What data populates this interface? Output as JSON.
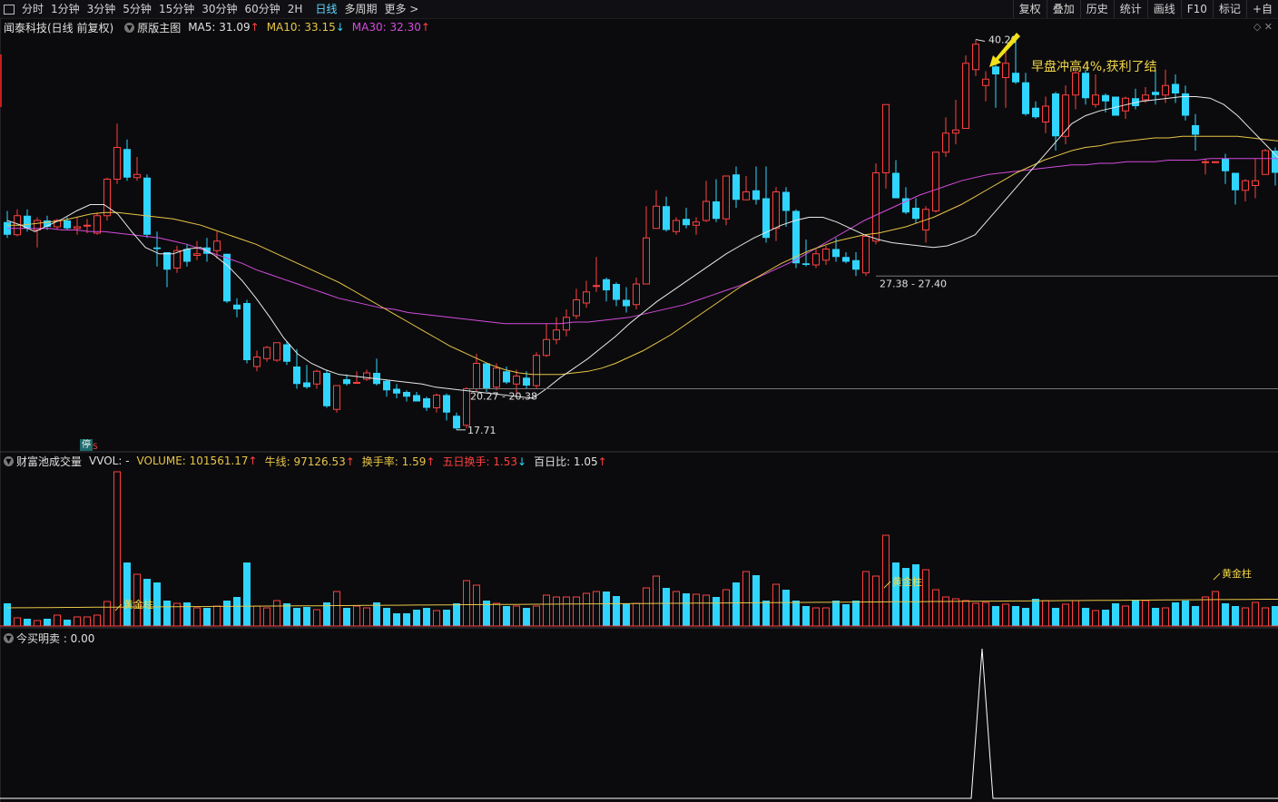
{
  "toolbar": {
    "periods": [
      "分时",
      "1分钟",
      "3分钟",
      "5分钟",
      "15分钟",
      "30分钟",
      "60分钟",
      "2H",
      "日线",
      "多周期",
      "更多 >"
    ],
    "active": "日线",
    "right": [
      "复权",
      "叠加",
      "历史",
      "统计",
      "画线",
      "F10",
      "标记",
      "+自"
    ]
  },
  "main": {
    "stock": "闻泰科技(日线 前复权)",
    "indicator": "原版主图",
    "ma5": "MA5: 31.09",
    "ma5_dir": "↑",
    "ma10": "MA10: 33.15",
    "ma10_dir": "↓",
    "ma30": "MA30: 32.30",
    "ma30_dir": "↑",
    "annotation": "早盘冲高4%,获利了结",
    "label_high": "40.20",
    "label_low": "17.71",
    "label_range1": "20.27 - 20.38",
    "label_range2": "27.38 - 27.40",
    "stop_badge": "停",
    "stop_s": "S"
  },
  "volume": {
    "title": "财富池成交量",
    "vvol": "VVOL: -",
    "volume": "VOLUME: 101561.17",
    "volume_dir": "↑",
    "bull": "牛线: 97126.53",
    "bull_dir": "↑",
    "turnover": "换手率: 1.59",
    "turnover_dir": "↑",
    "five_day": "五日换手: 1.53",
    "five_day_dir": "↓",
    "hundred": "百日比: 1.05",
    "hundred_dir": "↑",
    "golden": "黄金柱"
  },
  "bottom": {
    "title": "今买明卖 : 0.00"
  },
  "colors": {
    "up": "#ff4040",
    "down": "#30d5ff",
    "ma5": "#e8e8e8",
    "ma10": "#e8c547",
    "ma30": "#d44bdc",
    "background": "#0b0b0d"
  },
  "chart_data": {
    "type": "candlestick",
    "price_range": [
      16.5,
      42.5
    ],
    "candles": [
      [
        30.8,
        30.0,
        31.5,
        29.8
      ],
      [
        30.0,
        31.2,
        31.6,
        29.9
      ],
      [
        31.2,
        30.4,
        31.6,
        30.2
      ],
      [
        30.3,
        30.9,
        31.1,
        29.2
      ],
      [
        30.9,
        30.5,
        31.2,
        30.3
      ],
      [
        30.5,
        30.9,
        31.0,
        30.3
      ],
      [
        30.9,
        30.4,
        31.1,
        30.3
      ],
      [
        30.4,
        30.5,
        31.1,
        30.0
      ],
      [
        30.6,
        30.6,
        31.0,
        30.1
      ],
      [
        30.1,
        31.2,
        31.4,
        30.0
      ],
      [
        31.2,
        33.5,
        33.6,
        30.9
      ],
      [
        33.5,
        35.5,
        37.0,
        33.2
      ],
      [
        35.4,
        33.6,
        36.0,
        33.4
      ],
      [
        33.6,
        33.8,
        34.9,
        33.4
      ],
      [
        33.6,
        30.0,
        33.8,
        29.8
      ],
      [
        29.2,
        29.1,
        30.2,
        28.0
      ],
      [
        28.9,
        27.8,
        28.9,
        26.7
      ],
      [
        27.9,
        29.0,
        29.3,
        27.6
      ],
      [
        29.1,
        28.3,
        29.4,
        28.0
      ],
      [
        28.7,
        28.8,
        29.6,
        28.4
      ],
      [
        29.2,
        28.8,
        29.8,
        28.3
      ],
      [
        29.0,
        29.6,
        30.2,
        28.5
      ],
      [
        28.8,
        25.8,
        28.8,
        25.7
      ],
      [
        25.6,
        25.3,
        26.0,
        24.8
      ],
      [
        25.7,
        22.1,
        25.9,
        21.9
      ],
      [
        21.7,
        22.3,
        22.7,
        21.4
      ],
      [
        22.2,
        22.9,
        23.0,
        22.0
      ],
      [
        22.1,
        23.2,
        23.2,
        22.0
      ],
      [
        23.1,
        22.0,
        23.3,
        21.8
      ],
      [
        21.7,
        20.6,
        22.8,
        20.3
      ],
      [
        20.7,
        20.4,
        21.8,
        20.3
      ],
      [
        20.6,
        21.4,
        21.5,
        20.3
      ],
      [
        21.3,
        19.2,
        21.5,
        19.1
      ],
      [
        19.0,
        20.5,
        20.5,
        18.8
      ],
      [
        20.9,
        20.6,
        21.2,
        20.5
      ],
      [
        20.7,
        20.7,
        21.4,
        20.6
      ],
      [
        20.9,
        21.3,
        21.5,
        20.8
      ],
      [
        21.3,
        20.6,
        22.2,
        20.5
      ],
      [
        20.8,
        20.2,
        20.9,
        19.8
      ],
      [
        20.3,
        20.0,
        20.6,
        19.7
      ],
      [
        20.1,
        19.8,
        20.2,
        19.5
      ],
      [
        19.9,
        19.5,
        20.1,
        19.5
      ],
      [
        19.7,
        19.1,
        19.8,
        18.9
      ],
      [
        19.1,
        19.9,
        20.0,
        18.8
      ],
      [
        19.9,
        18.8,
        20.0,
        18.3
      ],
      [
        18.6,
        17.8,
        18.8,
        17.7
      ],
      [
        18.0,
        20.3,
        20.4,
        17.8
      ],
      [
        20.3,
        21.9,
        22.5,
        20.1
      ],
      [
        21.9,
        20.3,
        21.9,
        20.1
      ],
      [
        20.4,
        21.6,
        21.9,
        20.2
      ],
      [
        21.4,
        20.7,
        21.7,
        20.6
      ],
      [
        20.6,
        21.1,
        21.5,
        20.0
      ],
      [
        21.0,
        20.5,
        21.4,
        20.3
      ],
      [
        20.5,
        22.4,
        22.6,
        20.3
      ],
      [
        22.4,
        23.4,
        24.4,
        22.3
      ],
      [
        23.4,
        24.0,
        24.8,
        23.1
      ],
      [
        24.0,
        24.8,
        25.3,
        23.6
      ],
      [
        24.9,
        25.9,
        26.6,
        24.7
      ],
      [
        25.7,
        26.4,
        27.1,
        25.4
      ],
      [
        26.8,
        26.8,
        28.6,
        26.4
      ],
      [
        27.2,
        26.5,
        27.3,
        25.8
      ],
      [
        26.9,
        25.9,
        27.0,
        25.5
      ],
      [
        25.9,
        25.5,
        26.7,
        25.1
      ],
      [
        25.6,
        26.9,
        27.3,
        25.3
      ],
      [
        26.9,
        29.8,
        31.8,
        26.9
      ],
      [
        30.4,
        31.8,
        32.8,
        30.4
      ],
      [
        31.8,
        30.3,
        32.4,
        30.2
      ],
      [
        30.2,
        30.9,
        31.1,
        30.0
      ],
      [
        31.0,
        30.6,
        31.7,
        30.4
      ],
      [
        30.6,
        30.8,
        31.1,
        30.0
      ],
      [
        30.9,
        32.1,
        33.4,
        30.8
      ],
      [
        32.1,
        31.0,
        33.5,
        30.8
      ],
      [
        31.0,
        33.7,
        33.7,
        30.6
      ],
      [
        33.8,
        32.2,
        34.3,
        31.7
      ],
      [
        32.2,
        32.7,
        33.7,
        32.2
      ],
      [
        32.8,
        32.2,
        34.3,
        31.9
      ],
      [
        32.3,
        29.8,
        34.3,
        29.5
      ],
      [
        30.4,
        32.7,
        33.0,
        29.6
      ],
      [
        32.7,
        31.5,
        33.0,
        30.5
      ],
      [
        31.5,
        28.2,
        31.6,
        27.9
      ],
      [
        28.2,
        28.1,
        29.7,
        28.0
      ],
      [
        28.1,
        28.8,
        29.1,
        27.9
      ],
      [
        28.4,
        29.1,
        29.3,
        28.1
      ],
      [
        29.1,
        28.6,
        29.8,
        28.3
      ],
      [
        28.6,
        28.3,
        28.9,
        28.2
      ],
      [
        28.4,
        27.8,
        28.9,
        27.4
      ],
      [
        27.6,
        29.9,
        29.9,
        27.4
      ],
      [
        29.6,
        33.9,
        34.5,
        29.4
      ],
      [
        33.9,
        38.2,
        38.2,
        32.9
      ],
      [
        33.9,
        32.3,
        34.7,
        32.3
      ],
      [
        32.3,
        31.4,
        33.0,
        31.3
      ],
      [
        31.7,
        31.0,
        32.3,
        30.7
      ],
      [
        30.3,
        31.6,
        31.8,
        29.5
      ],
      [
        31.5,
        35.2,
        35.2,
        31.4
      ],
      [
        35.2,
        36.4,
        37.4,
        34.9
      ],
      [
        36.4,
        36.6,
        38.5,
        35.7
      ],
      [
        36.7,
        40.8,
        41.3,
        36.7
      ],
      [
        40.4,
        42.0,
        42.3,
        40.0
      ],
      [
        39.4,
        39.8,
        40.3,
        38.4
      ],
      [
        40.6,
        40.1,
        41.1,
        38.0
      ],
      [
        39.9,
        40.8,
        41.8,
        38.0
      ],
      [
        40.2,
        39.6,
        42.6,
        39.5
      ],
      [
        39.6,
        37.6,
        40.2,
        37.5
      ],
      [
        38.0,
        37.4,
        38.4,
        37.3
      ],
      [
        37.1,
        38.1,
        38.7,
        36.4
      ],
      [
        38.9,
        36.2,
        39.0,
        35.3
      ],
      [
        36.2,
        38.8,
        39.4,
        35.7
      ],
      [
        38.8,
        40.2,
        40.5,
        37.9
      ],
      [
        40.2,
        38.6,
        40.4,
        38.2
      ],
      [
        38.2,
        38.8,
        40.1,
        38.0
      ],
      [
        38.8,
        38.4,
        38.9,
        37.7
      ],
      [
        38.7,
        37.5,
        38.7,
        37.5
      ],
      [
        37.8,
        38.6,
        38.7,
        37.3
      ],
      [
        38.6,
        38.1,
        39.2,
        37.9
      ],
      [
        38.5,
        38.8,
        39.3,
        38.3
      ],
      [
        39.0,
        38.8,
        40.4,
        38.2
      ],
      [
        38.8,
        39.4,
        40.4,
        38.3
      ],
      [
        39.5,
        38.9,
        40.1,
        38.3
      ],
      [
        38.9,
        37.5,
        39.4,
        37.2
      ],
      [
        36.9,
        36.3,
        37.6,
        35.3
      ],
      [
        34.6,
        34.6,
        34.8,
        33.8
      ],
      [
        34.6,
        34.6,
        34.6,
        34.6
      ],
      [
        34.8,
        34.0,
        35.1,
        33.2
      ],
      [
        33.9,
        32.8,
        33.9,
        31.9
      ],
      [
        32.8,
        33.4,
        33.5,
        32.1
      ],
      [
        33.1,
        33.4,
        34.8,
        32.3
      ],
      [
        33.8,
        35.3,
        35.4,
        33.8
      ],
      [
        35.3,
        33.9,
        35.5,
        33.1
      ],
      [
        33.3,
        34.5,
        34.8,
        33.1
      ],
      [
        34.3,
        33.6,
        34.6,
        33.4
      ],
      [
        33.6,
        33.9,
        34.1,
        33.1
      ],
      [
        33.8,
        34.2,
        34.7,
        33.6
      ],
      [
        34.2,
        33.3,
        34.3,
        33.1
      ],
      [
        33.6,
        33.0,
        33.6,
        32.7
      ],
      [
        33.2,
        32.6,
        33.8,
        32.3
      ],
      [
        32.6,
        33.4,
        33.6,
        32.3
      ],
      [
        33.4,
        33.7,
        33.9,
        33.0
      ],
      [
        33.5,
        35.9,
        35.9,
        33.4
      ],
      [
        35.9,
        34.7,
        36.0,
        34.1
      ],
      [
        34.7,
        34.4,
        34.8,
        33.6
      ],
      [
        34.6,
        34.7,
        35.4,
        33.8
      ],
      [
        34.8,
        35.6,
        35.7,
        34.4
      ],
      [
        35.4,
        36.1,
        36.3,
        35.2
      ],
      [
        36.1,
        35.8,
        36.4,
        35.4
      ],
      [
        35.8,
        36.9,
        37.0,
        34.8
      ]
    ],
    "ma5": [
      30.9,
      30.6,
      30.2,
      30.6,
      31.0,
      31.5,
      31.9,
      31.9,
      31.3,
      30.2,
      29.2,
      28.8,
      28.8,
      29.1,
      29.2,
      28.7,
      28.0,
      27.1,
      26.0,
      24.8,
      23.5,
      22.5,
      21.9,
      21.5,
      21.2,
      21.1,
      21.0,
      20.9,
      20.8,
      20.7,
      20.6,
      20.4,
      20.3,
      20.2,
      20.1,
      20.0,
      19.9,
      19.8,
      19.7,
      20.3,
      21.0,
      21.6,
      22.2,
      22.9,
      23.6,
      24.4,
      25.1,
      25.8,
      26.4,
      27.0,
      27.6,
      28.2,
      28.8,
      29.3,
      29.8,
      30.2,
      30.6,
      30.9,
      31.1,
      31.1,
      30.8,
      30.4,
      30.0,
      29.7,
      29.5,
      29.4,
      29.3,
      29.2,
      29.3,
      29.6,
      30.0,
      31.0,
      32.0,
      33.0,
      34.0,
      35.0,
      36.0,
      37.0,
      37.5,
      37.8,
      38.0,
      38.2,
      38.4,
      38.5,
      38.6,
      38.7,
      38.7,
      38.6,
      38.2,
      37.5,
      36.6,
      35.7,
      34.8,
      34.1,
      33.6,
      33.2,
      33.1,
      33.3,
      33.5,
      33.7,
      33.9,
      34.0,
      34.1,
      34.3,
      34.8
    ],
    "ma10": [
      30.6,
      30.6,
      30.7,
      30.8,
      30.9,
      31.1,
      31.3,
      31.4,
      31.4,
      31.3,
      31.2,
      31.1,
      31.0,
      30.8,
      30.6,
      30.3,
      30.0,
      29.7,
      29.4,
      29.0,
      28.6,
      28.2,
      27.8,
      27.4,
      27.0,
      26.5,
      26.0,
      25.5,
      25.0,
      24.5,
      24.0,
      23.5,
      23.0,
      22.6,
      22.2,
      21.8,
      21.5,
      21.3,
      21.2,
      21.2,
      21.2,
      21.3,
      21.4,
      21.6,
      21.9,
      22.3,
      22.7,
      23.2,
      23.7,
      24.3,
      24.9,
      25.5,
      26.1,
      26.7,
      27.2,
      27.7,
      28.2,
      28.6,
      29.0,
      29.3,
      29.6,
      29.8,
      30.0,
      30.1,
      30.3,
      30.5,
      30.8,
      31.1,
      31.5,
      31.9,
      32.4,
      32.9,
      33.4,
      33.9,
      34.3,
      34.7,
      35.0,
      35.3,
      35.5,
      35.6,
      35.8,
      35.9,
      36.0,
      36.1,
      36.1,
      36.2,
      36.2,
      36.2,
      36.2,
      36.2,
      36.1,
      36.0,
      35.9,
      35.8,
      35.6,
      35.5,
      35.3,
      35.2,
      35.0,
      34.9,
      34.8,
      34.7,
      34.6,
      34.6,
      34.6
    ],
    "ma30": [
      30.4,
      30.4,
      30.4,
      30.4,
      30.3,
      30.3,
      30.2,
      30.2,
      30.1,
      30.0,
      29.9,
      29.8,
      29.6,
      29.4,
      29.1,
      28.8,
      28.5,
      28.2,
      27.8,
      27.5,
      27.2,
      26.9,
      26.6,
      26.3,
      26.0,
      25.8,
      25.6,
      25.4,
      25.3,
      25.1,
      25.0,
      24.9,
      24.8,
      24.7,
      24.6,
      24.5,
      24.4,
      24.4,
      24.4,
      24.4,
      24.4,
      24.5,
      24.5,
      24.6,
      24.7,
      24.8,
      25.0,
      25.2,
      25.4,
      25.6,
      25.9,
      26.2,
      26.5,
      26.8,
      27.2,
      27.6,
      28.0,
      28.4,
      28.9,
      29.4,
      29.9,
      30.4,
      30.9,
      31.3,
      31.7,
      32.1,
      32.5,
      32.8,
      33.1,
      33.4,
      33.6,
      33.8,
      33.9,
      34.0,
      34.1,
      34.2,
      34.3,
      34.4,
      34.4,
      34.5,
      34.5,
      34.6,
      34.6,
      34.6,
      34.7,
      34.7,
      34.7,
      34.8,
      34.8,
      34.8,
      34.8,
      34.8,
      34.8,
      34.8,
      34.9,
      34.9,
      34.9,
      34.9,
      35.0,
      35.0,
      35.0,
      35.0,
      35.1,
      35.1,
      35.1
    ],
    "volume_max": 170000
  }
}
